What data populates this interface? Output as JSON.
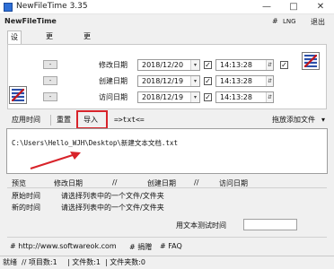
{
  "window": {
    "title": "NewFileTime 3.35",
    "minimize": "—",
    "maximize": "□",
    "close": "✕"
  },
  "header": {
    "app_name": "NewFileTime",
    "hash_label": "#",
    "lng_label": "LNG",
    "exit_label": "退出"
  },
  "tabs": [
    {
      "label": "设置时间"
    },
    {
      "label": "更早一些"
    },
    {
      "label": "更晚一些"
    }
  ],
  "rows": [
    {
      "minus": "-",
      "label": "修改日期",
      "date": "2018/12/20",
      "time": "14:13:28"
    },
    {
      "minus": "-",
      "label": "创建日期",
      "date": "2018/12/19",
      "time": "14:13:28"
    },
    {
      "minus": "-",
      "label": "访问日期",
      "date": "2018/12/19",
      "time": "14:13:28"
    }
  ],
  "toolbar": {
    "apply_time": "应用时间",
    "reset": "重置",
    "import": "导入",
    "txt_arrow": "=>txt<=",
    "drag_add": "拖放添加文件",
    "dropdown_glyph": "▾"
  },
  "file_list": {
    "path": "C:\\Users\\Hello_WJH\\Desktop\\新建文本文档.txt"
  },
  "info": {
    "headers": [
      "预览",
      "修改日期",
      "//",
      "创建日期",
      "//",
      "访问日期"
    ],
    "original_label": "原始时间",
    "original_value": "请选择列表中的一个文件/文件夹",
    "new_label": "新的时间",
    "new_value": "请选择列表中的一个文件/文件夹",
    "text_time_label": "用文本测试时间"
  },
  "links": [
    {
      "text": "# http://www.softwareok.com"
    },
    {
      "text": "# 捐赠"
    },
    {
      "text": "# FAQ"
    }
  ],
  "status": {
    "ready": "就绪",
    "items": "// 项目数:1",
    "files": "| 文件数:1",
    "folders": "| 文件夹数:0"
  },
  "colors": {
    "highlight": "#d8232a",
    "arrow": "#d8232a"
  }
}
